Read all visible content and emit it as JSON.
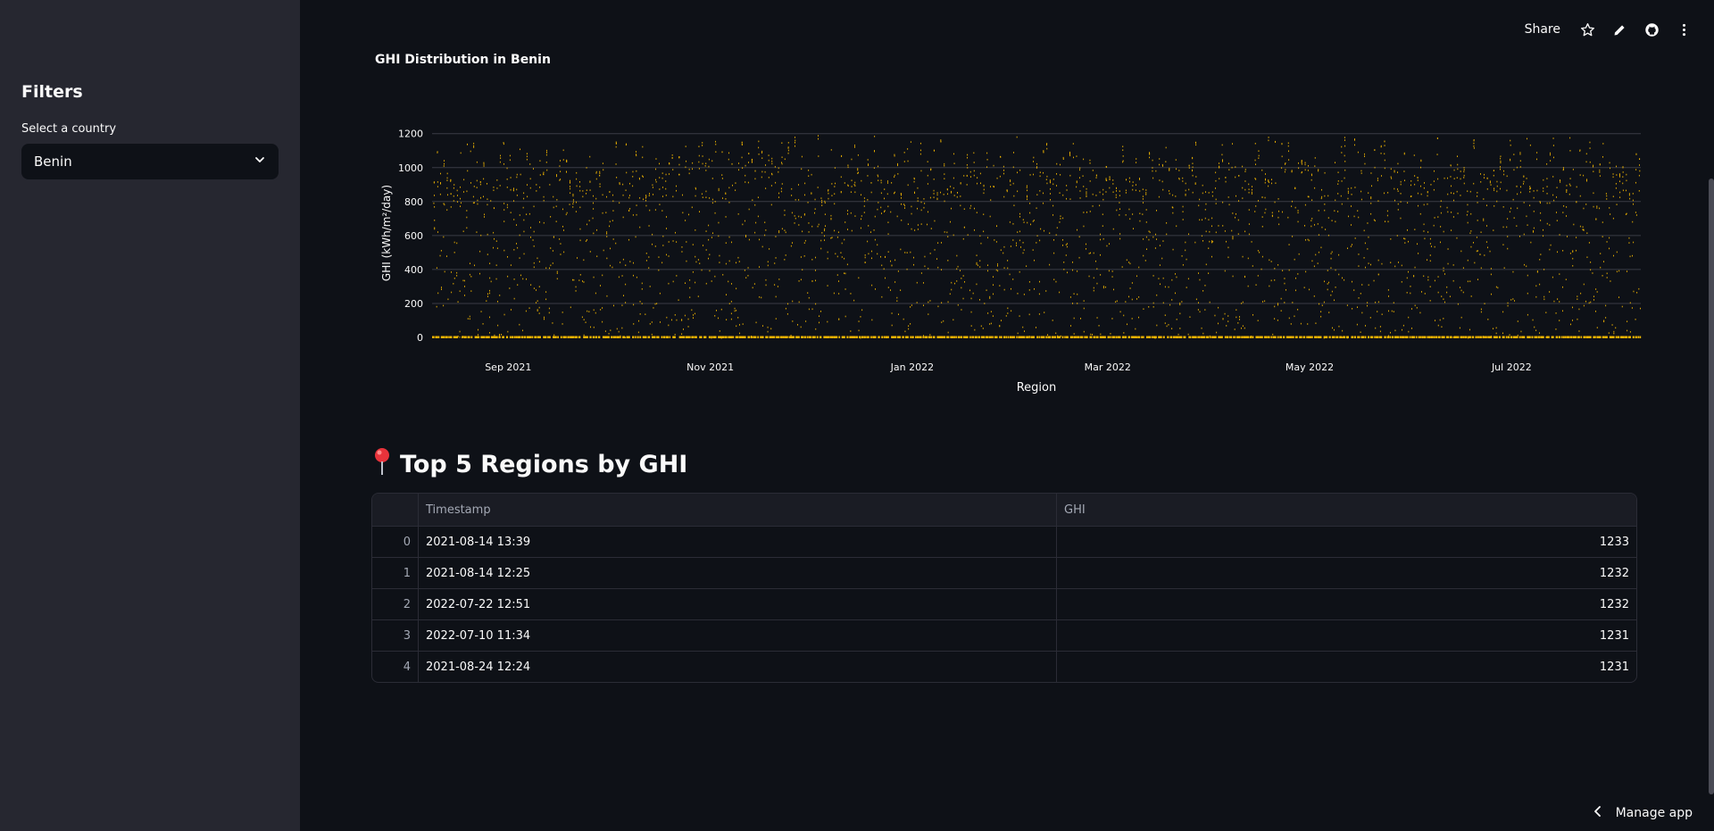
{
  "sidebar": {
    "title": "Filters",
    "country_label": "Select a country",
    "country_value": "Benin"
  },
  "header": {
    "share_label": "Share",
    "icons": [
      "star-icon",
      "pencil-icon",
      "github-icon",
      "more-vertical-icon"
    ]
  },
  "chart": {
    "title": "GHI Distribution in Benin"
  },
  "chart_data": {
    "type": "scatter",
    "title": "GHI Distribution in Benin",
    "xlabel": "Region",
    "ylabel": "GHI (kWh/m²/day)",
    "x_range": [
      "2021-08-09",
      "2022-08-09"
    ],
    "x_ticks": [
      "Sep 2021",
      "Nov 2021",
      "Jan 2022",
      "Mar 2022",
      "May 2022",
      "Jul 2022"
    ],
    "ylim": [
      0,
      1230
    ],
    "y_ticks": [
      0,
      200,
      400,
      600,
      800,
      1000,
      1200
    ],
    "grid": true,
    "color": "#f5b800",
    "approx_daily_max": 1000
  },
  "section": {
    "title": "Top 5 Regions by GHI"
  },
  "table": {
    "columns": [
      "",
      "Timestamp",
      "GHI"
    ],
    "rows": [
      {
        "idx": "0",
        "ts": "2021-08-14 13:39",
        "ghi": "1233"
      },
      {
        "idx": "1",
        "ts": "2021-08-14 12:25",
        "ghi": "1232"
      },
      {
        "idx": "2",
        "ts": "2022-07-22 12:51",
        "ghi": "1232"
      },
      {
        "idx": "3",
        "ts": "2022-07-10 11:34",
        "ghi": "1231"
      },
      {
        "idx": "4",
        "ts": "2021-08-24 12:24",
        "ghi": "1231"
      }
    ]
  },
  "footer": {
    "manage_label": "Manage app"
  },
  "colors": {
    "background": "#0e1117",
    "sidebar": "#262730",
    "accent": "#f5b800"
  }
}
